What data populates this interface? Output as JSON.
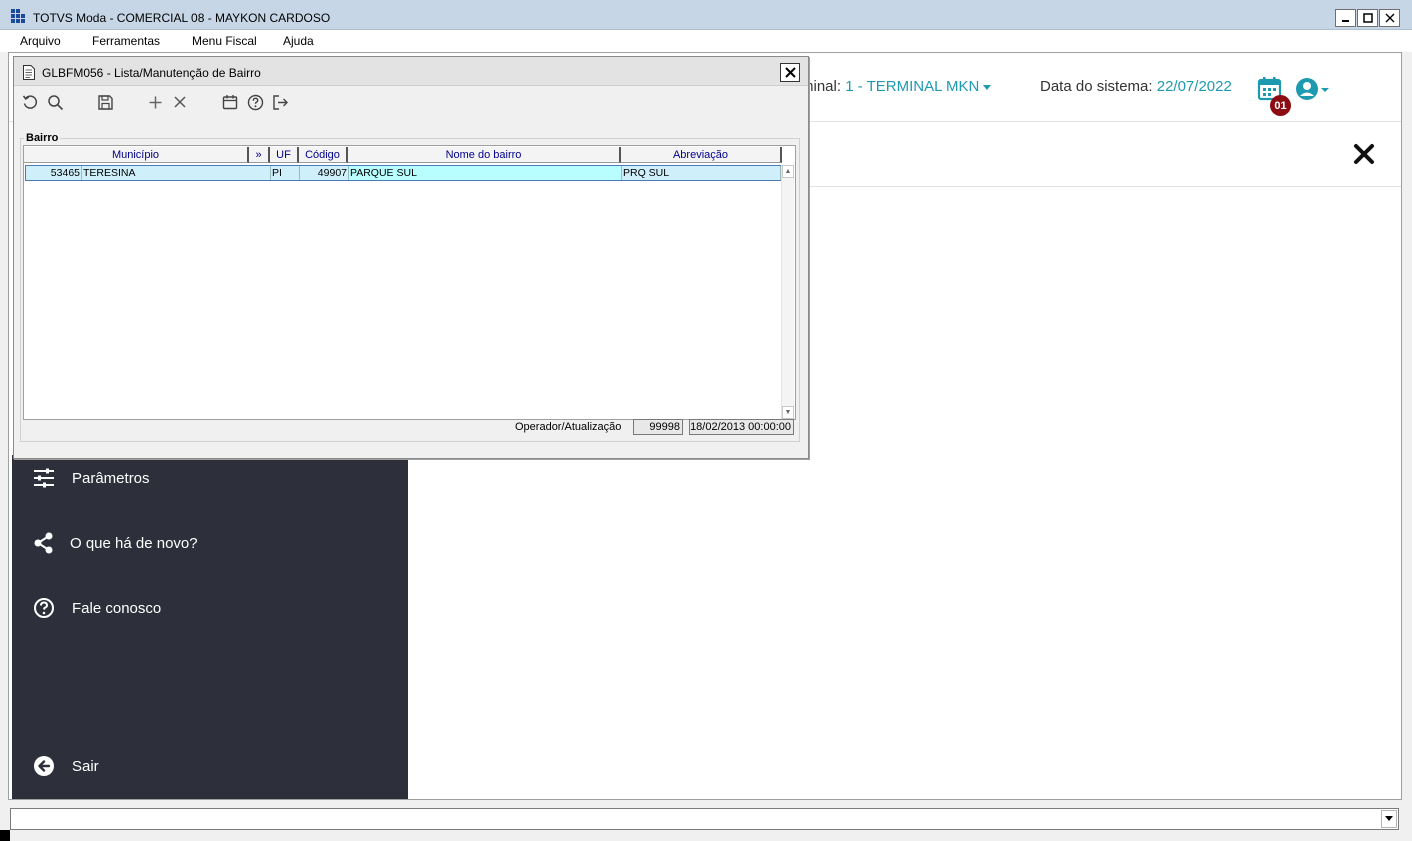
{
  "window": {
    "title": "TOTVS Moda - COMERCIAL 08 - MAYKON CARDOSO"
  },
  "menu": [
    {
      "label": "Arquivo"
    },
    {
      "label": "Ferramentas"
    },
    {
      "label": "Menu Fiscal"
    },
    {
      "label": "Ajuda"
    }
  ],
  "header": {
    "terminal_label": "minal:",
    "terminal_value": "1 - TERMINAL MKN",
    "sysdate_label": "Data do sistema:",
    "sysdate_value": "22/07/2022",
    "badge": "01"
  },
  "sidebar": {
    "items": [
      {
        "label": "Parâmetros",
        "icon": "sliders-icon"
      },
      {
        "label": "O que há de novo?",
        "icon": "share-icon"
      },
      {
        "label": "Fale conosco",
        "icon": "help-circle-icon"
      },
      {
        "label": "Sair",
        "icon": "arrow-left-circle-icon"
      }
    ]
  },
  "dialog": {
    "title": "GLBFM056 - Lista/Manutenção de Bairro",
    "group_label": "Bairro",
    "columns": [
      "Município",
      "»",
      "UF",
      "Código",
      "Nome do bairro",
      "Abreviação"
    ],
    "rows": [
      {
        "municipio_cod": "53465",
        "municipio_nome": "TERESINA",
        "uf": "PI",
        "codigo": "49907",
        "nome": "PARQUE SUL",
        "abreviacao": "PRQ SUL"
      }
    ],
    "footer": {
      "operator_label": "Operador/Atualização",
      "operator": "99998",
      "updated": "18/02/2013 00:00:00"
    }
  },
  "colors": {
    "sidebar_bg": "#2d303b",
    "accent": "#1e9ab0",
    "badge": "#8b0d13",
    "titlebar": "#c7d6e6"
  }
}
